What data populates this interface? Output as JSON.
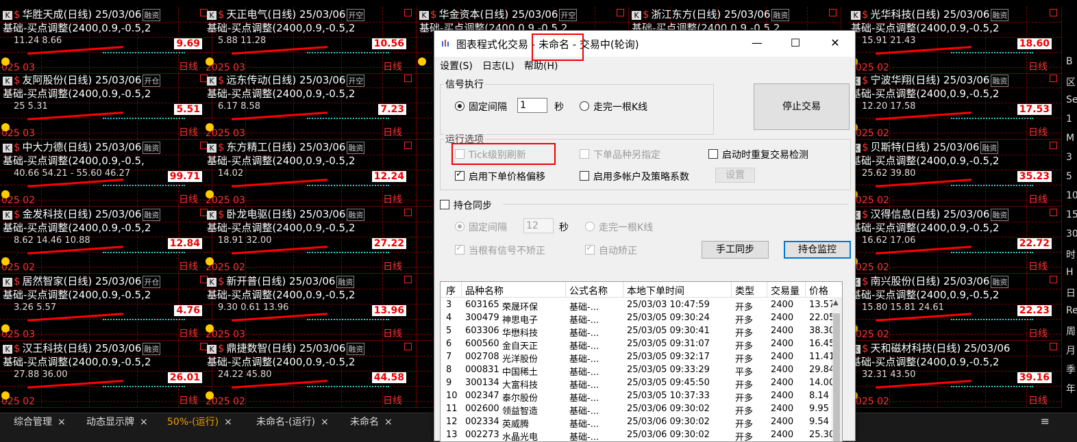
{
  "grid": {
    "cells": [
      {
        "name": "华胜天成(日线)",
        "date": "25/03/06",
        "badge": "融资",
        "formula": "基础-买点调整(2400,0.9,-0.5,2",
        "vals": "11.24    8.66",
        "price": "9.69",
        "d1": "025",
        "d2": "03",
        "day": "日线"
      },
      {
        "name": "天正电气(日线)",
        "date": "25/03/06",
        "badge": "开空",
        "formula": "基础-买点调整(2400,0.9,-0.5,2",
        "vals": "5.88          11.28",
        "price": "10.56",
        "d1": "2025",
        "d2": "03",
        "day": "日线"
      },
      {
        "name": "华金资本(日线)",
        "date": "25/03/06",
        "badge": "开空",
        "formula": "基础-买点调整(2400,0.9,-0.5,2",
        "vals": "",
        "price": "",
        "d1": "",
        "d2": "",
        "day": ""
      },
      {
        "name": "浙江东方(日线)",
        "date": "25/03/06",
        "badge": "融资",
        "formula": "基础-买点调整(2400,0.9,-0.5,2",
        "vals": "",
        "price": "",
        "d1": "",
        "d2": "",
        "day": ""
      },
      {
        "name": "光华科技(日线)",
        "date": "25/03/06",
        "badge": "融资",
        "formula": "基础-买点调整(2400,0.9,-0.5,2",
        "vals": "15.91         21.43",
        "price": "18.60",
        "d1": "2025",
        "d2": "02",
        "day": "日线"
      },
      {
        "name": "友阿股份(日线)",
        "date": "25/03/06",
        "badge": "开仓",
        "formula": "基础-买点调整(2400,0.9,-0.5,2",
        "vals": "25      5.31",
        "price": "5.51",
        "d1": "025",
        "d2": "03",
        "day": "日线"
      },
      {
        "name": "远东传动(日线)",
        "date": "25/03/06",
        "badge": "开空",
        "formula": "基础-买点调整(2400,0.9,-0.5,2",
        "vals": "6.17        8.58",
        "price": "7.23",
        "d1": "2025",
        "d2": "03",
        "day": "日线"
      },
      {
        "name": "",
        "date": "",
        "badge": "",
        "formula": "",
        "vals": "",
        "price": "",
        "d1": "",
        "d2": "",
        "day": ""
      },
      {
        "name": "",
        "date": "",
        "badge": "",
        "formula": "",
        "vals": "",
        "price": "",
        "d1": "",
        "d2": "",
        "day": ""
      },
      {
        "name": "宁波华翔(日线)",
        "date": "25/03/06",
        "badge": "融资",
        "formula": "基础-买点调整(2400,0.9,-0.5,2",
        "vals": "12.20         17.58",
        "price": "17.53",
        "d1": "2025",
        "d2": "02",
        "day": "日线"
      },
      {
        "name": "中大力德(日线)",
        "date": "25/03/06",
        "badge": "融资",
        "formula": "基础-买点调整(2400,0.9,-0.5,",
        "vals": "40.66  54.21 - 55.60  46.27",
        "price": "99.71",
        "d1": "025",
        "d2": "02",
        "day": "日线"
      },
      {
        "name": "东方精工(日线)",
        "date": "25/03/06",
        "badge": "融资",
        "formula": "基础-买点调整(2400,0.9,-0.5,2",
        "vals": "              14.02",
        "price": "12.24",
        "d1": "2025",
        "d2": "03",
        "day": "日线"
      },
      {
        "name": "",
        "date": "",
        "badge": "",
        "formula": "",
        "vals": "",
        "price": "",
        "d1": "",
        "d2": "",
        "day": ""
      },
      {
        "name": "",
        "date": "",
        "badge": "",
        "formula": "",
        "vals": "",
        "price": "",
        "d1": "",
        "d2": "",
        "day": ""
      },
      {
        "name": "贝斯特(日线)",
        "date": "25/03/06",
        "badge": "融资",
        "formula": "基础-买点调整(2400,0.9,-0.5,2",
        "vals": "25.62       39.80",
        "price": "35.23",
        "d1": "2025",
        "d2": "02",
        "day": "日线"
      },
      {
        "name": "金发科技(日线)",
        "date": "25/03/06",
        "badge": "融资",
        "formula": "基础-买点调整(2400,0.9,-0.5,2",
        "vals": "8.62    14.46  10.88",
        "price": "12.84",
        "d1": "025",
        "d2": "02",
        "day": "日线"
      },
      {
        "name": "卧龙电驱(日线)",
        "date": "25/03/06",
        "badge": "融资",
        "formula": "基础-买点调整(2400,0.9,-0.5,2",
        "vals": "18.91        32.00",
        "price": "27.22",
        "d1": "2025",
        "d2": "02",
        "day": "日线"
      },
      {
        "name": "",
        "date": "",
        "badge": "",
        "formula": "",
        "vals": "",
        "price": "",
        "d1": "",
        "d2": "",
        "day": ""
      },
      {
        "name": "",
        "date": "",
        "badge": "",
        "formula": "",
        "vals": "",
        "price": "",
        "d1": "",
        "d2": "",
        "day": ""
      },
      {
        "name": "汉得信息(日线)",
        "date": "25/03/06",
        "badge": "融资",
        "formula": "基础-买点调整(2400,0.9,-0.5,2",
        "vals": "16.62   17.06",
        "price": "22.72",
        "d1": "2025",
        "d2": "02",
        "day": "日线"
      },
      {
        "name": "居然智家(日线)",
        "date": "25/03/06",
        "badge": "开仓",
        "formula": "基础-买点调整(2400,0.9,-0.5,2",
        "vals": "3.26     5.57",
        "price": "4.76",
        "d1": "025",
        "d2": "03",
        "day": "日线"
      },
      {
        "name": "新开普(日线)",
        "date": "25/03/06",
        "badge": "融资",
        "formula": "基础-买点调整(2400,0.9,-0.5,2",
        "vals": "9.30   0.61      13.96",
        "price": "13.96",
        "d1": "2025",
        "d2": "03",
        "day": "日线"
      },
      {
        "name": "",
        "date": "",
        "badge": "",
        "formula": "",
        "vals": "",
        "price": "",
        "d1": "",
        "d2": "",
        "day": ""
      },
      {
        "name": "",
        "date": "",
        "badge": "",
        "formula": "",
        "vals": "",
        "price": "",
        "d1": "",
        "d2": "",
        "day": ""
      },
      {
        "name": "南兴股份(日线)",
        "date": "25/03/06",
        "badge": "融资",
        "formula": "基础-买点调整(2400,0.9,-0.5,2",
        "vals": "15.80  15.81  24.61",
        "price": "22.23",
        "d1": "2025",
        "d2": "02",
        "day": "日线"
      },
      {
        "name": "汉王科技(日线)",
        "date": "25/03/06",
        "badge": "融资",
        "formula": "基础-买点调整(2400,0.9,-0.5,2",
        "vals": "27.88    36.00",
        "price": "26.01",
        "d1": "025",
        "d2": "02",
        "day": "日线"
      },
      {
        "name": "鼎捷数智(日线)",
        "date": "25/03/06",
        "badge": "融资",
        "formula": "基础-买点调整(2400,0.9,-0.5,2",
        "vals": "24.22  45.80",
        "price": "44.58",
        "d1": "2025",
        "d2": "02",
        "day": "日线"
      },
      {
        "name": "",
        "date": "",
        "badge": "",
        "formula": "",
        "vals": "",
        "price": "",
        "d1": "",
        "d2": "",
        "day": ""
      },
      {
        "name": "",
        "date": "",
        "badge": "",
        "formula": "",
        "vals": "",
        "price": "",
        "d1": "",
        "d2": "",
        "day": ""
      },
      {
        "name": "天和磁材科技(日线)",
        "date": "25/03/06",
        "badge": "",
        "formula": "基础-买点调整(2400,0.9,-0.5,2",
        "vals": "32.31    43.50",
        "price": "39.16",
        "d1": "2025",
        "d2": "02",
        "day": "日线"
      }
    ],
    "right_strip": [
      "B",
      "区",
      "Se",
      "1",
      "M",
      "3",
      "5",
      "10",
      "15",
      "30",
      "时",
      "H",
      "日",
      "Re",
      "周",
      "月",
      "季",
      "年"
    ]
  },
  "tabs": [
    {
      "label": "综合管理",
      "close": "×"
    },
    {
      "label": "动态显示牌",
      "close": "×"
    },
    {
      "label": "50%-(运行)",
      "close": "×"
    },
    {
      "label": "未命名-(运行)",
      "close": "×"
    },
    {
      "label": "未命名",
      "close": "×"
    }
  ],
  "menu_icon": "≡",
  "dialog": {
    "title_prefix": "图表程式化交易 - ",
    "title_name": "未命名",
    "title_suffix": " - 交易中(轮询)",
    "menus": [
      "设置(S)",
      "日志(L)",
      "帮助(H)"
    ],
    "signal": {
      "legend": "信号执行",
      "fixed_interval": "固定间隔",
      "interval_value": "1",
      "unit": "秒",
      "per_bar": "走完一根K线",
      "stop_button": "停止交易"
    },
    "options": {
      "legend": "运行选项",
      "tick_refresh": "Tick级别刷新",
      "order_other": "下单品种另指定",
      "restart_check": "启动时重复交易检测",
      "price_offset": "启用下单价格偏移",
      "multi_account": "启用多帐户及策略系数",
      "settings_button": "设置"
    },
    "position": {
      "sync": "持仓同步",
      "fixed_interval": "固定间隔",
      "interval_value": "12",
      "unit": "秒",
      "per_bar": "走完一根K线",
      "no_correct": "当根有信号不矫正",
      "auto_correct": "自动矫正",
      "manual_sync": "手工同步",
      "monitor": "持仓监控"
    },
    "table": {
      "headers": [
        "序",
        "品种名称",
        "公式名称",
        "本地下单时间",
        "类型",
        "交易量",
        "价格"
      ],
      "rows": [
        [
          "3",
          "603165",
          "荣晟环保",
          "基础-...",
          "25/03/03 10:47:59",
          "开多",
          "2400",
          "13.57"
        ],
        [
          "4",
          "300479",
          "神思电子",
          "基础-...",
          "25/03/05 09:30:24",
          "开多",
          "2400",
          "22.05"
        ],
        [
          "5",
          "603306",
          "华懋科技",
          "基础-...",
          "25/03/05 09:30:41",
          "开多",
          "2400",
          "38.30"
        ],
        [
          "6",
          "600560",
          "金自天正",
          "基础-...",
          "25/03/05 09:31:07",
          "开多",
          "2400",
          "16.45"
        ],
        [
          "7",
          "002708",
          "光洋股份",
          "基础-...",
          "25/03/05 09:32:17",
          "开多",
          "2400",
          "11.41"
        ],
        [
          "8",
          "000831",
          "中国稀土",
          "基础-...",
          "25/03/05 09:33:29",
          "平多",
          "2400",
          "29.84"
        ],
        [
          "9",
          "300134",
          "大富科技",
          "基础-...",
          "25/03/05 09:45:50",
          "开多",
          "2400",
          "14.00"
        ],
        [
          "10",
          "002347",
          "泰尔股份",
          "基础-...",
          "25/03/05 10:37:33",
          "开多",
          "2400",
          "8.14"
        ],
        [
          "11",
          "002600",
          "领益智造",
          "基础-...",
          "25/03/06 09:30:02",
          "开多",
          "2400",
          "9.95"
        ],
        [
          "12",
          "002334",
          "英威腾",
          "基础-...",
          "25/03/06 09:30:02",
          "开多",
          "2400",
          "9.54"
        ],
        [
          "13",
          "002273",
          "水晶光电",
          "基础-...",
          "25/03/06 09:30:02",
          "开多",
          "2400",
          "25.30"
        ]
      ]
    }
  }
}
